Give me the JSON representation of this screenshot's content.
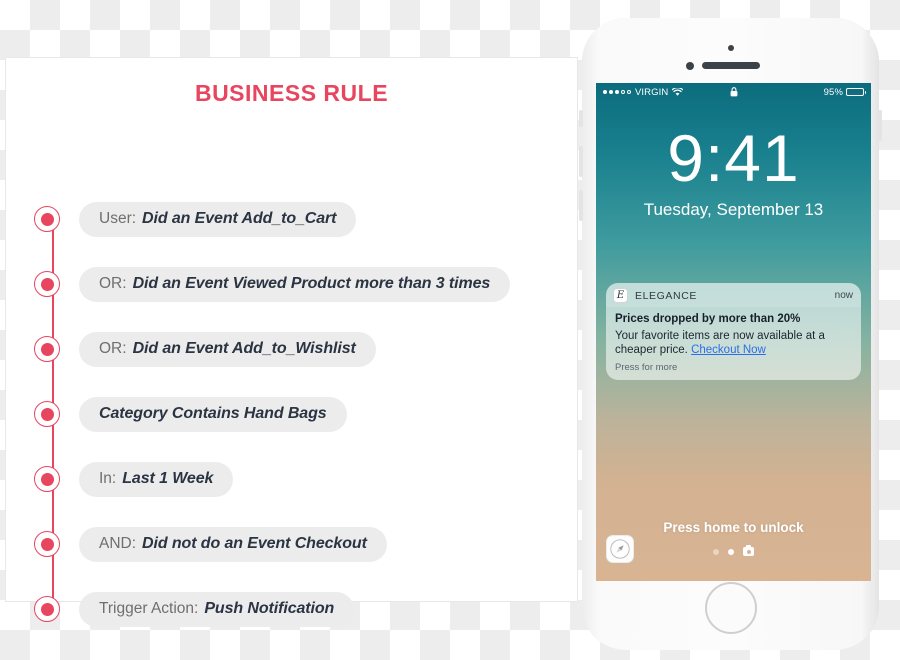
{
  "card": {
    "title": "BUSINESS RULE",
    "title_color": "#e8455f",
    "rules": [
      {
        "prefix": "User:",
        "value": "Did an Event  Add_to_Cart"
      },
      {
        "prefix": "OR:",
        "value": "Did an Event Viewed Product more than 3 times"
      },
      {
        "prefix": "OR:",
        "value": "Did an Event Add_to_Wishlist"
      },
      {
        "prefix": "",
        "value": "Category Contains Hand Bags"
      },
      {
        "prefix": "In:",
        "value": "Last 1 Week"
      },
      {
        "prefix": "AND:",
        "value": "Did not do an Event Checkout"
      },
      {
        "prefix": "Trigger Action:",
        "value": "Push Notification"
      }
    ]
  },
  "phone": {
    "status_bar": {
      "carrier": "VIRGIN",
      "signal_filled": 3,
      "signal_hollow": 2,
      "wifi_icon": "wifi-icon",
      "lock_icon": "lock-icon",
      "battery_percent": "95%",
      "battery_level": 95
    },
    "lock_screen": {
      "time": "9:41",
      "date": "Tuesday, September 13",
      "unlock_hint": "Press home to unlock",
      "safari_icon": "safari-compass-icon",
      "camera_icon": "camera-icon",
      "page_dots": 2
    },
    "notification": {
      "app_icon_letter": "E",
      "app_name": "ELEGANCE",
      "time": "now",
      "title": "Prices dropped by more than 20%",
      "body": "Your favorite items are now available at a cheaper price. ",
      "link": "Checkout Now",
      "link_color": "#2a6fe8",
      "hint": "Press for more"
    }
  }
}
